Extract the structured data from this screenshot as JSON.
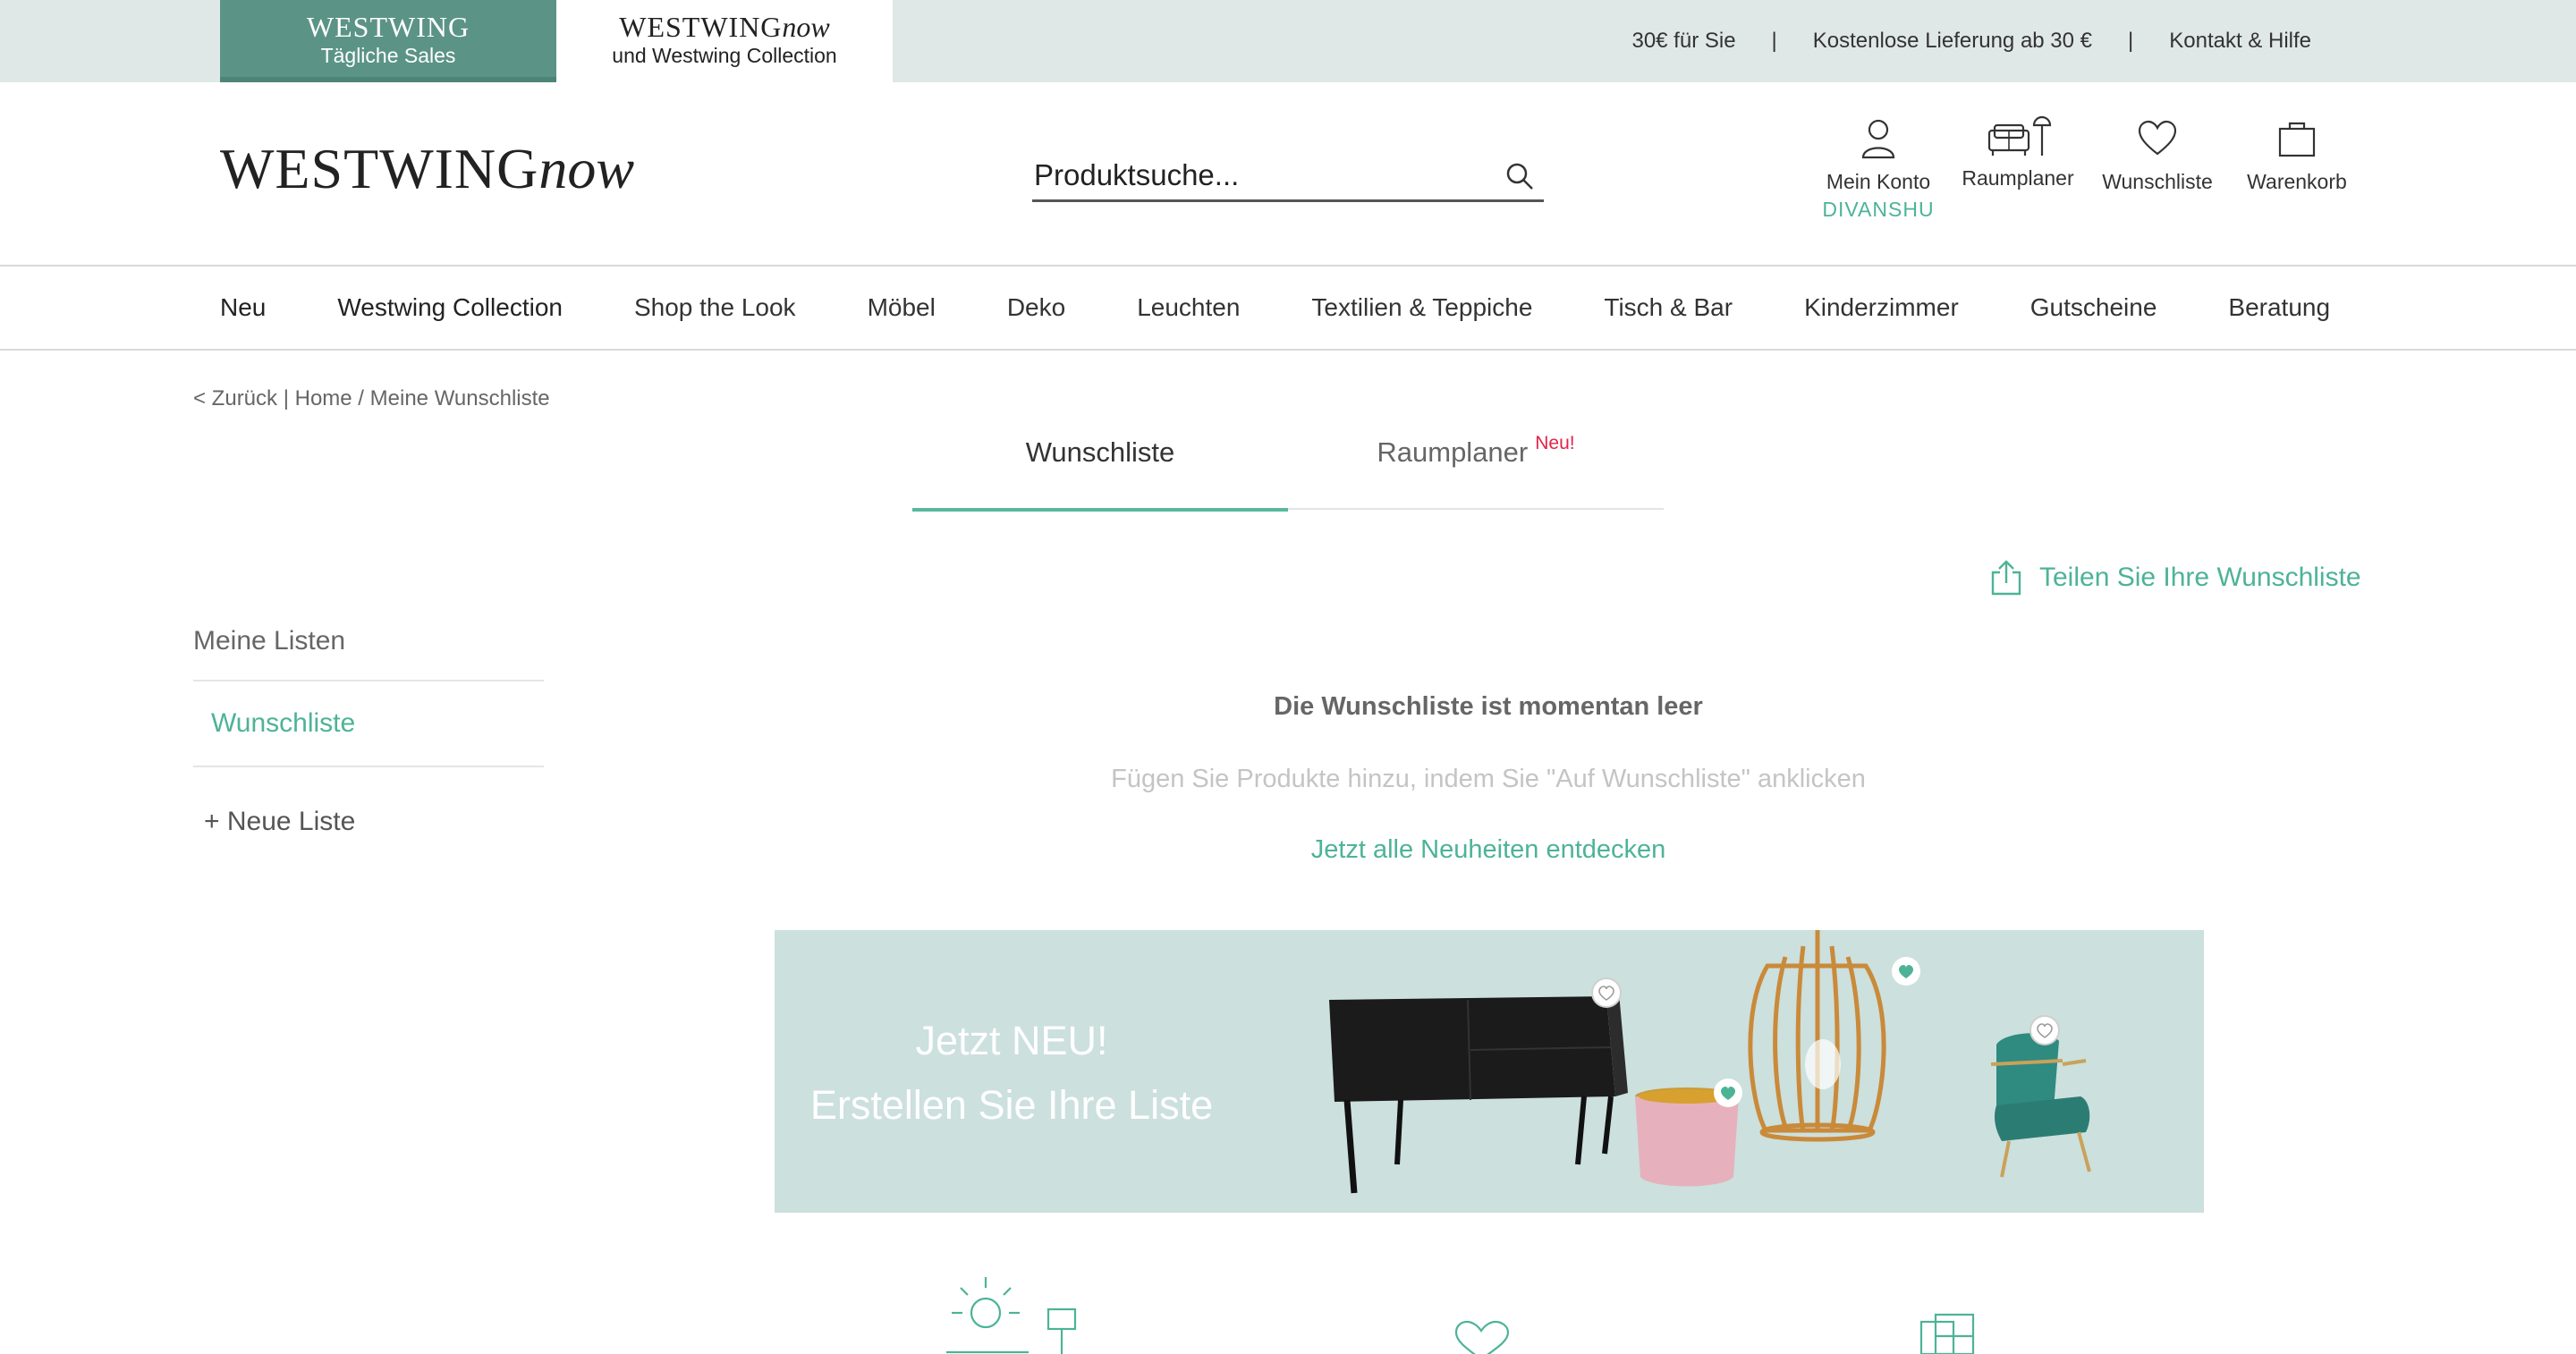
{
  "topbar": {
    "tab_sales": {
      "brand": "WESTWING",
      "label": "Tägliche Sales"
    },
    "tab_now": {
      "brand_main": "WESTWING",
      "brand_italic": "now",
      "label": "und Westwing Collection"
    },
    "links": [
      "30€ für Sie",
      "Kostenlose Lieferung ab 30 €",
      "Kontakt & Hilfe"
    ],
    "separator": "|"
  },
  "header": {
    "logo_main": "WESTWING",
    "logo_italic": "now",
    "search_placeholder": "Produktsuche...",
    "icons": [
      {
        "label": "Mein Konto",
        "sub": "DIVANSHU",
        "icon": "user-icon"
      },
      {
        "label": "Raumplaner",
        "icon": "room-planner-icon"
      },
      {
        "label": "Wunschliste",
        "icon": "heart-icon"
      },
      {
        "label": "Warenkorb",
        "icon": "bag-icon"
      }
    ]
  },
  "nav": {
    "items": [
      "Neu",
      "Westwing Collection",
      "Shop the Look",
      "Möbel",
      "Deko",
      "Leuchten",
      "Textilien & Teppiche",
      "Tisch & Bar",
      "Kinderzimmer",
      "Gutscheine",
      "Beratung"
    ]
  },
  "breadcrumb": {
    "back": "< Zurück",
    "sep1": " | ",
    "home": "Home",
    "sep2": " / ",
    "current": "Meine Wunschliste"
  },
  "tabs": {
    "wishlist": "Wunschliste",
    "planner": "Raumplaner",
    "planner_badge": "Neu!"
  },
  "share": {
    "label": "Teilen Sie Ihre Wunschliste"
  },
  "sidebar": {
    "heading": "Meine Listen",
    "active_item": "Wunschliste",
    "new_list": "+ Neue Liste"
  },
  "empty": {
    "title": "Die Wunschliste ist momentan leer",
    "hint": "Fügen Sie Produkte hinzu, indem Sie \"Auf Wunschliste\" anklicken",
    "cta": "Jetzt alle Neuheiten entdecken"
  },
  "banner": {
    "line1": "Jetzt NEU!",
    "line2": "Erstellen Sie Ihre Liste"
  },
  "colors": {
    "accent": "#4db397",
    "topbar_bg": "#dfe8e6",
    "sales_tab": "#5b9486",
    "banner_bg": "#cce0dd",
    "badge_red": "#e2234a"
  }
}
